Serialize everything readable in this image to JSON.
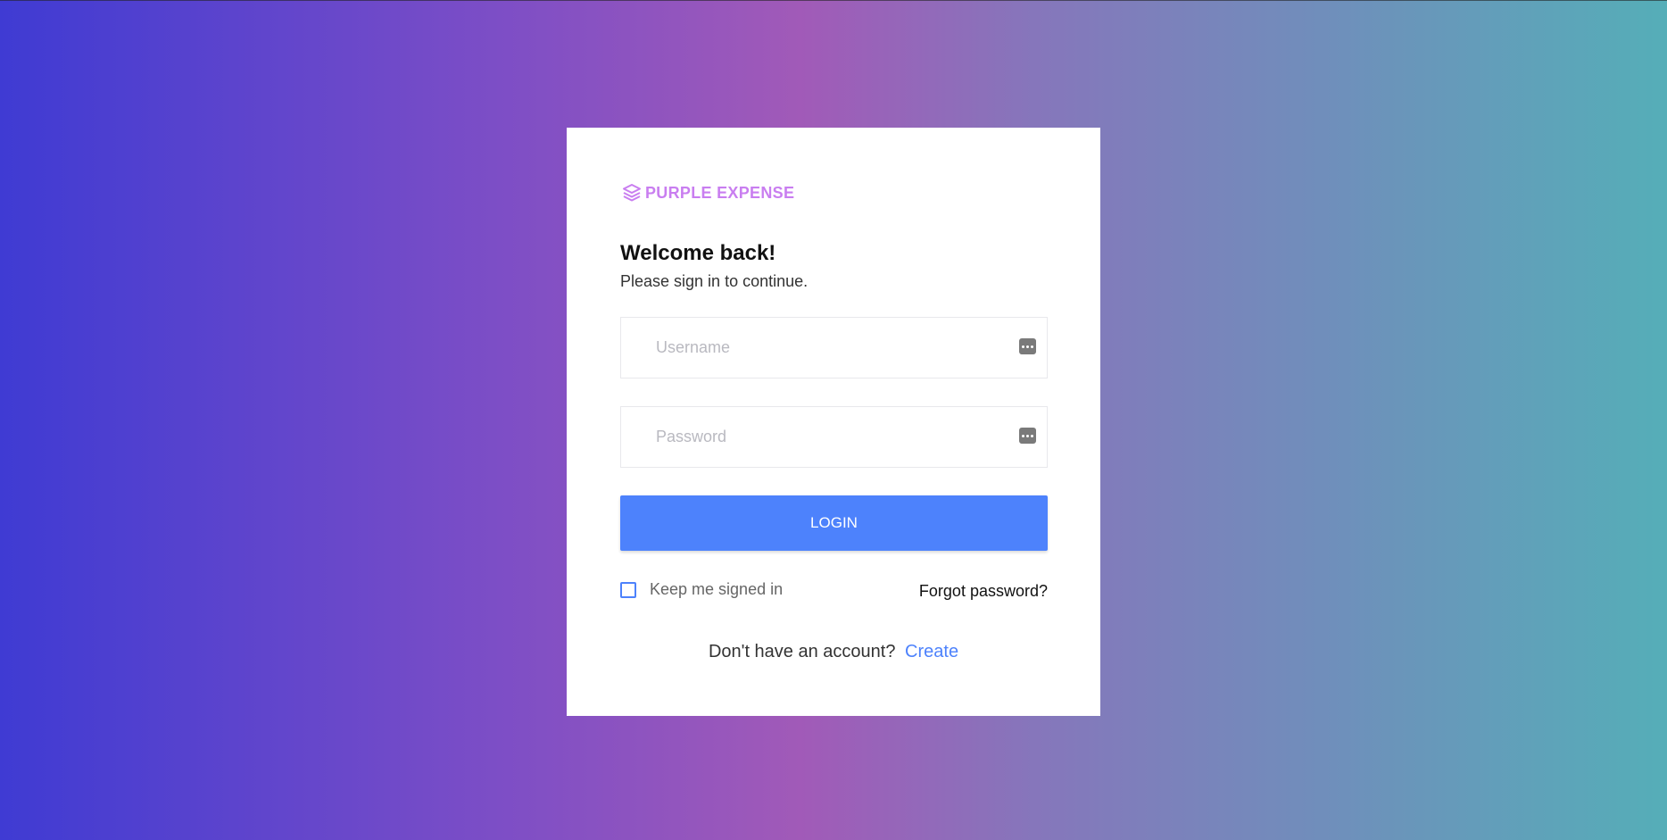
{
  "brand": {
    "name": "PURPLE EXPENSE",
    "color": "#c97ef0",
    "icon": "layers-icon"
  },
  "heading": {
    "title": "Welcome back!",
    "subtitle": "Please sign in to continue."
  },
  "form": {
    "username": {
      "placeholder": "Username",
      "value": "",
      "icon": "password-manager-key-icon"
    },
    "password": {
      "placeholder": "Password",
      "value": "",
      "icon": "password-manager-key-icon"
    },
    "login_label": "LOGIN",
    "keep_signed_in_label": "Keep me signed in",
    "keep_signed_in_checked": false,
    "forgot_password_label": "Forgot password?"
  },
  "signup": {
    "prompt": "Don't have an account?",
    "link_label": "Create"
  },
  "colors": {
    "accent": "#4d82fc",
    "background_start": "#3f3bd3",
    "background_mid": "#a15ab8",
    "background_end": "#55aeb8"
  }
}
